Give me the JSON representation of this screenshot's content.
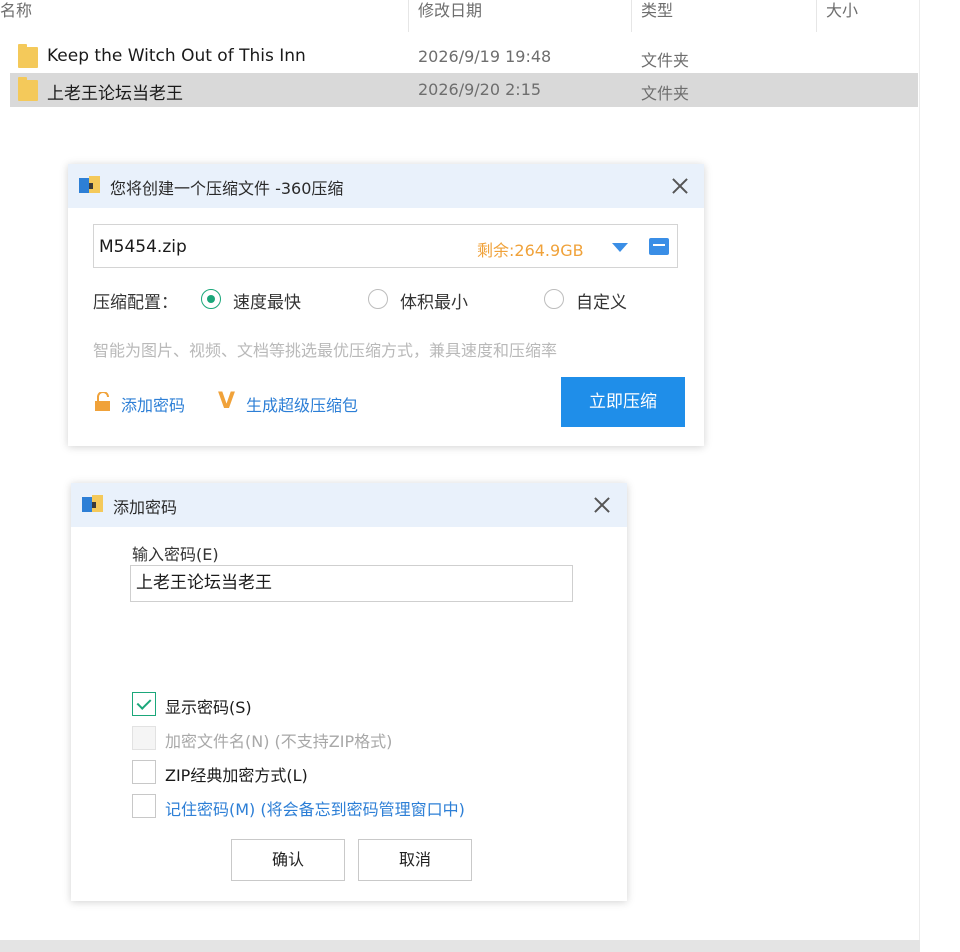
{
  "explorer": {
    "columns": {
      "name": "名称",
      "modified": "修改日期",
      "type": "类型",
      "size": "大小"
    },
    "rows": [
      {
        "name": "Keep the Witch Out of This Inn",
        "modified": "2026/9/19 19:48",
        "type": "文件夹",
        "selected": false
      },
      {
        "name": "上老王论坛当老王",
        "modified": "2026/9/20 2:15",
        "type": "文件夹",
        "selected": true
      }
    ]
  },
  "compress_dialog": {
    "title": "您将创建一个压缩文件 -360压缩",
    "filename": "M5454.zip",
    "space_left": "剩余:264.9GB",
    "config_label": "压缩配置：",
    "options": [
      {
        "label": "速度最快",
        "selected": true
      },
      {
        "label": "体积最小",
        "selected": false
      },
      {
        "label": "自定义",
        "selected": false
      }
    ],
    "hint": "智能为图片、视频、文档等挑选最优压缩方式，兼具速度和压缩率",
    "add_password": "添加密码",
    "super_package": "生成超级压缩包",
    "super_icon_letter": "V",
    "compress_button": "立即压缩"
  },
  "password_dialog": {
    "title": "添加密码",
    "input_label": "输入密码(E)",
    "password_value": "上老王论坛当老王",
    "checkboxes": [
      {
        "label": "显示密码(S)",
        "checked": true,
        "disabled": false
      },
      {
        "label": "加密文件名(N) (不支持ZIP格式)",
        "checked": false,
        "disabled": true
      },
      {
        "label": "ZIP经典加密方式(L)",
        "checked": false,
        "disabled": false
      },
      {
        "label": "记住密码(M) (将会备忘到密码管理窗口中)",
        "checked": false,
        "disabled": false
      }
    ],
    "ok_button": "确认",
    "cancel_button": "取消"
  },
  "colors": {
    "accent_blue": "#1f8ee9",
    "link_blue": "#2d7fd6",
    "space_orange": "#f0a23a",
    "check_green": "#1ba77a",
    "title_bar": "#e9f1fb",
    "selected_row": "#d9d9d9",
    "folder_yellow": "#f4c95a"
  },
  "icons": [
    "folder-icon",
    "archive-app-icon",
    "close-icon",
    "dropdown-arrow-icon",
    "browse-folder-icon",
    "lock-icon",
    "vip-v-icon",
    "checkmark-icon"
  ]
}
